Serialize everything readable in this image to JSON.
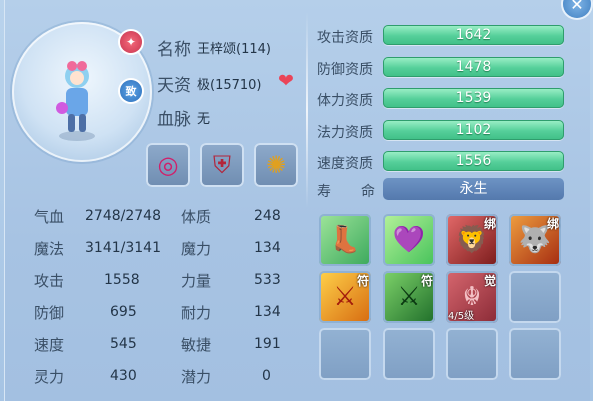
{
  "pet": {
    "name_label": "名称",
    "name": "王梓颂(114)",
    "aptitude_label": "天资",
    "aptitude": "极(15710)",
    "bloodline_label": "血脉",
    "bloodline": "无",
    "badge_zhi": "致"
  },
  "attributes": [
    {
      "label": "攻击资质",
      "value": "1642"
    },
    {
      "label": "防御资质",
      "value": "1478"
    },
    {
      "label": "体力资质",
      "value": "1539"
    },
    {
      "label": "法力资质",
      "value": "1102"
    },
    {
      "label": "速度资质",
      "value": "1556"
    }
  ],
  "life": {
    "label_a": "寿",
    "label_b": "命",
    "value": "永生"
  },
  "stats": {
    "left": [
      {
        "label": "气血",
        "value": "2748/2748"
      },
      {
        "label": "魔法",
        "value": "3141/3141"
      },
      {
        "label": "攻击",
        "value": "1558"
      },
      {
        "label": "防御",
        "value": "695"
      },
      {
        "label": "速度",
        "value": "545"
      },
      {
        "label": "灵力",
        "value": "430"
      }
    ],
    "right": [
      {
        "label": "体质",
        "value": "248"
      },
      {
        "label": "魔力",
        "value": "134"
      },
      {
        "label": "力量",
        "value": "533"
      },
      {
        "label": "耐力",
        "value": "134"
      },
      {
        "label": "敏捷",
        "value": "191"
      },
      {
        "label": "潜力",
        "value": "0"
      }
    ]
  },
  "skills": [
    {
      "icon": "boot-skill-icon",
      "tag": "",
      "level": ""
    },
    {
      "icon": "heart-shield-skill-icon",
      "tag": "",
      "level": ""
    },
    {
      "icon": "lion-skill-icon",
      "tag": "绑",
      "level": ""
    },
    {
      "icon": "beast-skill-icon",
      "tag": "绑",
      "level": ""
    },
    {
      "icon": "spear-skill-icon",
      "tag": "符",
      "level": ""
    },
    {
      "icon": "warrior-skill-icon",
      "tag": "符",
      "level": ""
    },
    {
      "icon": "awaken-skill-icon",
      "tag": "觉",
      "level": "4/5级"
    }
  ],
  "equipment": [
    "dragon-ring-icon",
    "armor-icon",
    "necklace-icon"
  ],
  "colors": {
    "bar_green": "#55cf9a",
    "life_blue": "#5479ad",
    "heart_red": "#ea4458"
  }
}
